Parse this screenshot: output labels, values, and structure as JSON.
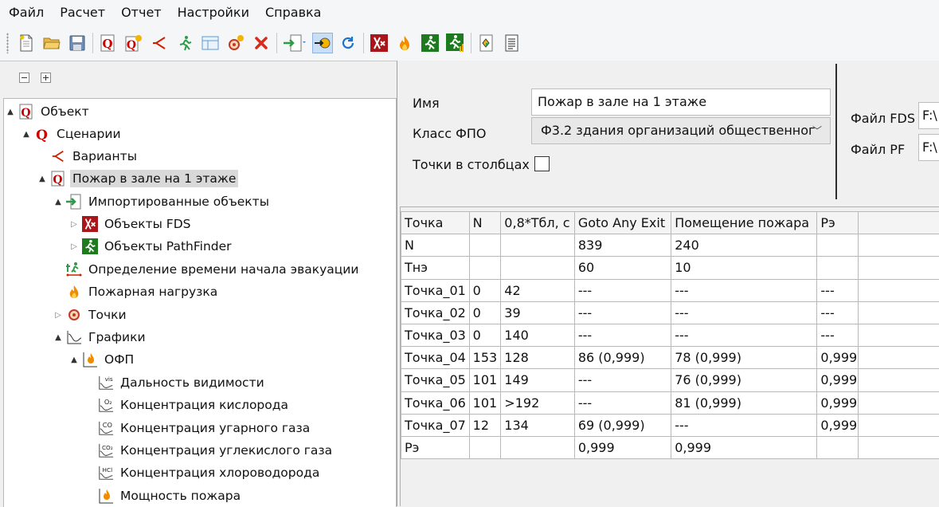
{
  "menu": [
    "Файл",
    "Расчет",
    "Отчет",
    "Настройки",
    "Справка"
  ],
  "tree": {
    "nodes": [
      {
        "label": "Объект",
        "expander": "▲"
      },
      {
        "label": "Сценарии",
        "expander": "▲"
      },
      {
        "label": "Варианты",
        "expander": ""
      },
      {
        "label": "Пожар в зале на 1 этаже",
        "expander": "▲"
      },
      {
        "label": "Импортированные объекты",
        "expander": "▲"
      },
      {
        "label": "Объекты FDS",
        "expander": "▷"
      },
      {
        "label": "Объекты PathFinder",
        "expander": "▷"
      },
      {
        "label": "Определение времени начала эвакуации",
        "expander": ""
      },
      {
        "label": "Пожарная нагрузка",
        "expander": ""
      },
      {
        "label": "Точки",
        "expander": "▷"
      },
      {
        "label": "Графики",
        "expander": "▲"
      },
      {
        "label": "ОФП",
        "expander": "▲"
      },
      {
        "label": "Дальность видимости",
        "expander": ""
      },
      {
        "label": "Концентрация кислорода",
        "expander": ""
      },
      {
        "label": "Концентрация угарного газа",
        "expander": ""
      },
      {
        "label": "Концентрация углекислого газа",
        "expander": ""
      },
      {
        "label": "Концентрация хлороводорода",
        "expander": ""
      },
      {
        "label": "Мощность пожара",
        "expander": ""
      }
    ]
  },
  "props": {
    "name_label": "Имя",
    "name_value": "Пожар в зале на 1 этаже",
    "class_label": "Класс ФПО",
    "class_value": "Ф3.2 здания организаций общественног",
    "columns_label": "Точки в столбцах",
    "fds_label": "Файл FDS",
    "fds_value": "F:\\",
    "pf_label": "Файл PF",
    "pf_value": "F:\\"
  },
  "grid": {
    "headers": [
      "Точка",
      "N",
      "0,8*Тбл, с",
      "Goto Any Exit",
      "Помещение пожара",
      "Рэ",
      ""
    ],
    "rows": [
      [
        "N",
        "",
        "",
        "839",
        "240",
        "",
        ""
      ],
      [
        "Тнэ",
        "",
        "",
        "60",
        "10",
        "",
        ""
      ],
      [
        "Точка_01",
        "0",
        "42",
        "---",
        "---",
        "---",
        ""
      ],
      [
        "Точка_02",
        "0",
        "39",
        "---",
        "---",
        "---",
        ""
      ],
      [
        "Точка_03",
        "0",
        "140",
        "---",
        "---",
        "---",
        ""
      ],
      [
        "Точка_04",
        "153",
        "128",
        "86 (0,999)",
        "78 (0,999)",
        "0,999",
        ""
      ],
      [
        "Точка_05",
        "101",
        "149",
        "---",
        "76 (0,999)",
        "0,999",
        ""
      ],
      [
        "Точка_06",
        "101",
        ">192",
        "---",
        "81 (0,999)",
        "0,999",
        ""
      ],
      [
        "Точка_07",
        "12",
        "134",
        "69 (0,999)",
        "---",
        "0,999",
        ""
      ],
      [
        "Рэ",
        "",
        "",
        "0,999",
        "0,999",
        "",
        ""
      ]
    ]
  },
  "colors": {
    "accent_red": "#cc0000",
    "accent_green": "#1e7a1e",
    "fire_orange": "#f08c00"
  }
}
